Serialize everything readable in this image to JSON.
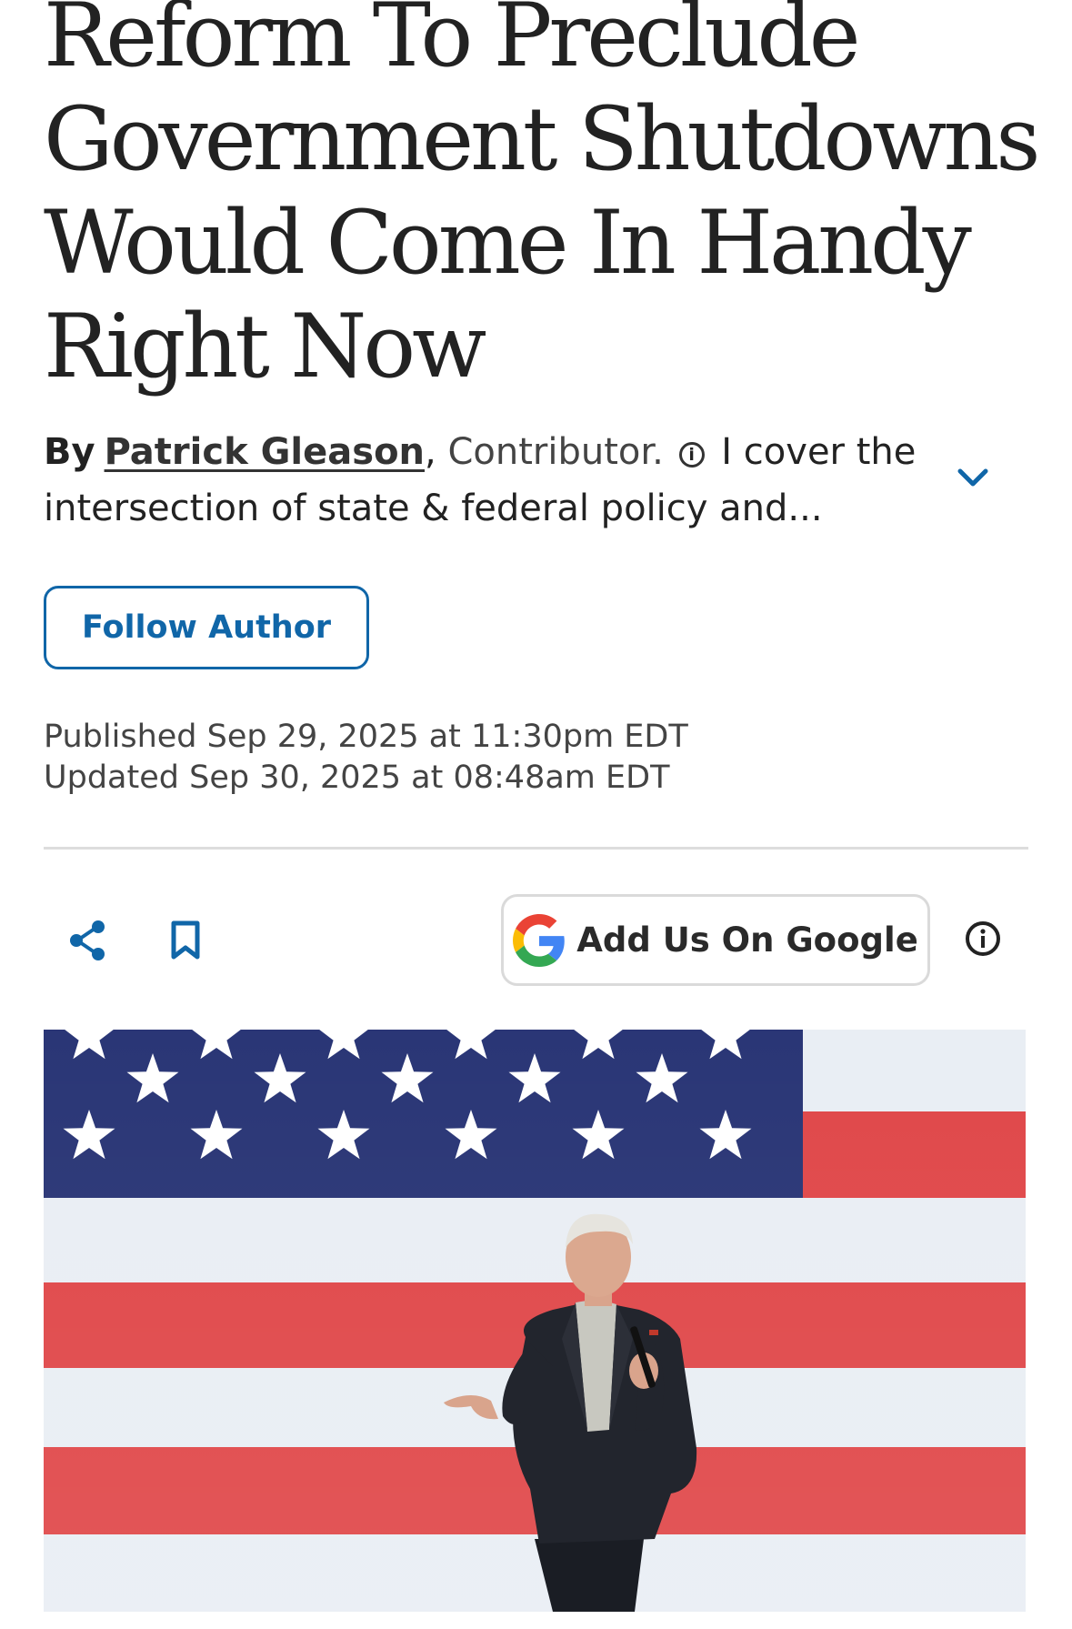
{
  "article": {
    "headline_lines": [
      "Reform To Preclude",
      "Government Shutdowns",
      "Would Come In Handy",
      "Right Now"
    ],
    "byline": {
      "by": "By",
      "author": "Patrick Gleason",
      "comma": ",",
      "role": "Contributor.",
      "bio": "I cover the intersection of state & federal policy and..."
    },
    "follow_label": "Follow Author",
    "published": "Published Sep 29, 2025 at 11:30pm EDT",
    "updated": "Updated Sep 30, 2025 at 08:48am EDT"
  },
  "actions": {
    "google_label": "Add Us On Google"
  },
  "icons": {
    "info_small": "info-icon",
    "expand": "chevron-down-icon",
    "share": "share-icon",
    "bookmark": "bookmark-icon",
    "google": "google-logo-icon",
    "info": "info-icon"
  },
  "colors": {
    "accent": "#1066a8",
    "text": "#222222",
    "muted": "#444444",
    "divider": "#dddddd"
  }
}
